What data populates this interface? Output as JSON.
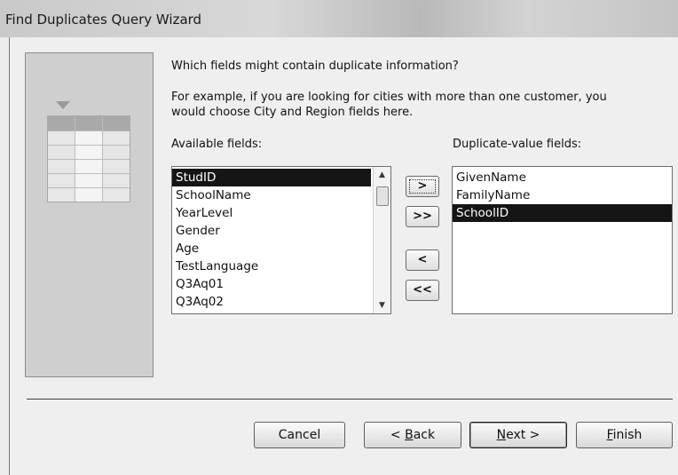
{
  "window": {
    "title": "Find Duplicates Query Wizard"
  },
  "prompt": {
    "question": "Which fields might contain duplicate information?",
    "example_line1": "For example, if you are looking for cities with more than one customer, you",
    "example_line2": "would choose City and Region fields here."
  },
  "available": {
    "label": "Available fields:",
    "items": [
      "StudID",
      "SchoolName",
      "YearLevel",
      "Gender",
      "Age",
      "TestLanguage",
      "Q3Aq01",
      "Q3Aq02"
    ],
    "selected": "StudID"
  },
  "duplicate": {
    "label": "Duplicate-value fields:",
    "items": [
      "GivenName",
      "FamilyName",
      "SchoolID"
    ],
    "selected": "SchoolID"
  },
  "move_buttons": {
    "add_one": ">",
    "add_all": ">>",
    "remove_one": "<",
    "remove_all": "<<"
  },
  "footer": {
    "cancel": "Cancel",
    "back_prefix": "< ",
    "back_key": "B",
    "back_rest": "ack",
    "next_key": "N",
    "next_rest": "ext >",
    "finish_key": "F",
    "finish_rest": "inish"
  },
  "icons": {
    "scroll_up": "▲",
    "scroll_down": "▼"
  }
}
